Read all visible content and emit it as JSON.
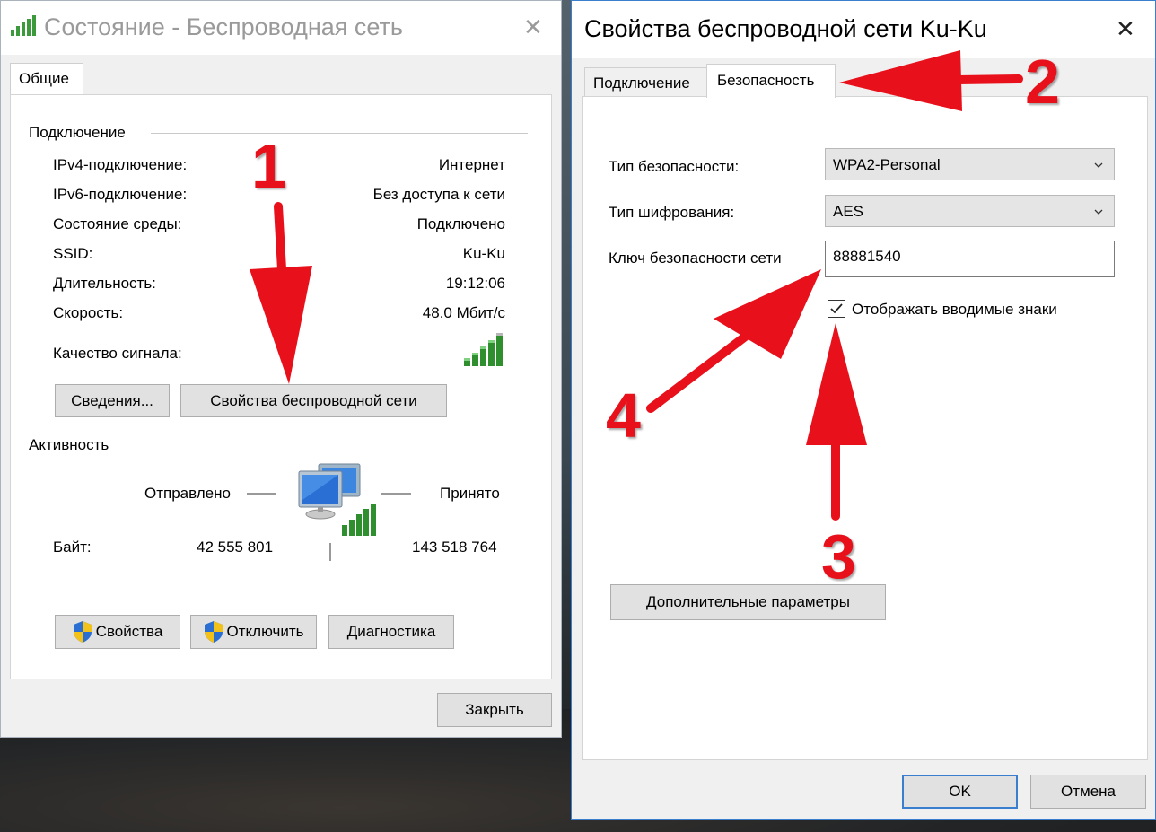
{
  "status_window": {
    "title": "Состояние - Беспроводная сеть",
    "tabs": [
      {
        "label": "Общие"
      }
    ],
    "connection_group": "Подключение",
    "rows": [
      {
        "label": "IPv4-подключение:",
        "value": "Интернет"
      },
      {
        "label": "IPv6-подключение:",
        "value": "Без доступа к сети"
      },
      {
        "label": "Состояние среды:",
        "value": "Подключено"
      },
      {
        "label": "SSID:",
        "value": "Ku-Ku"
      },
      {
        "label": "Длительность:",
        "value": "19:12:06"
      },
      {
        "label": "Скорость:",
        "value": "48.0 Мбит/с"
      }
    ],
    "signal_label": "Качество сигнала:",
    "details_button": "Сведения...",
    "wireless_props_button": "Свойства беспроводной сети",
    "activity_group": "Активность",
    "sent_label": "Отправлено",
    "received_label": "Принято",
    "bytes_label": "Байт:",
    "bytes_sent": "42 555 801",
    "bytes_received": "143 518 764",
    "properties_button": "Свойства",
    "disable_button": "Отключить",
    "diagnostics_button": "Диагностика",
    "close_button": "Закрыть"
  },
  "props_window": {
    "title": "Свойства беспроводной сети Ku-Ku",
    "tabs": [
      {
        "label": "Подключение",
        "active": false
      },
      {
        "label": "Безопасность",
        "active": true
      }
    ],
    "security_type_label": "Тип безопасности:",
    "security_type_value": "WPA2-Personal",
    "encryption_type_label": "Тип шифрования:",
    "encryption_type_value": "AES",
    "network_key_label": "Ключ безопасности сети",
    "network_key_value": "88881540",
    "show_chars_label": "Отображать вводимые знаки",
    "show_chars_checked": true,
    "advanced_button": "Дополнительные параметры",
    "ok_button": "OK",
    "cancel_button": "Отмена"
  },
  "annotations": {
    "n1": "1",
    "n2": "2",
    "n3": "3",
    "n4": "4",
    "arrow_color": "#e8101a"
  },
  "colors": {
    "signal_green": "#2f8f2f",
    "shield_blue": "#2a6fd1",
    "shield_yellow": "#f2c21b",
    "focus_blue": "#3a7fcf"
  },
  "icons": {
    "title_wifi": "wifi-signal-icon",
    "signal": "signal-strength-icon",
    "activity": "network-computers-icon",
    "uac": "uac-shield-icon",
    "check": "checkmark-icon",
    "dropdown": "chevron-down-icon"
  }
}
